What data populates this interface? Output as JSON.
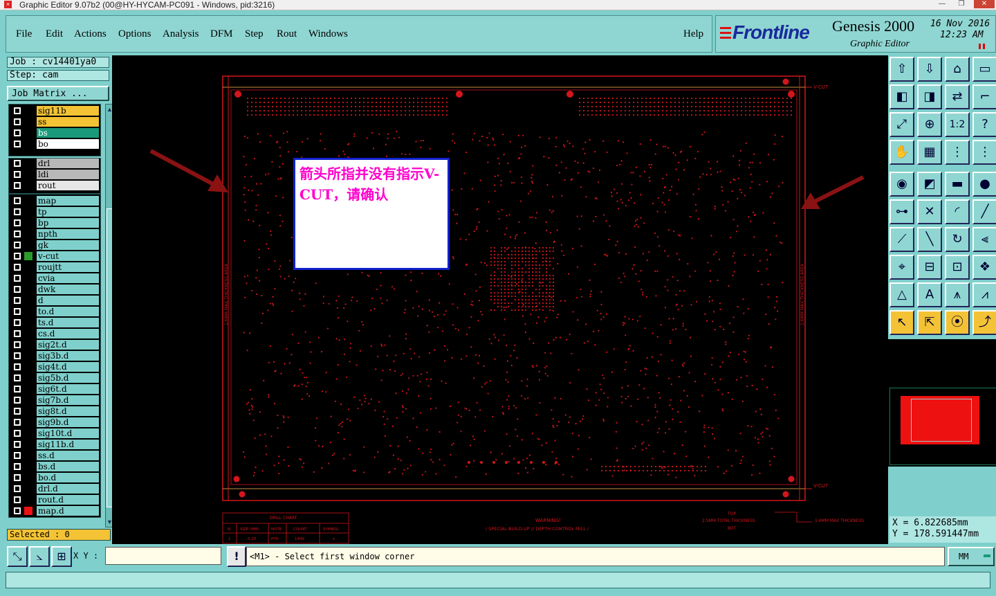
{
  "window": {
    "title": "Graphic Editor 9.07b2 (00@HY-HYCAM-PC091 - Windows, pid:3216)",
    "minimize": "—",
    "maximize": "❐",
    "close": "✕"
  },
  "menu": {
    "items": [
      "File",
      "Edit",
      "Actions",
      "Options",
      "Analysis",
      "DFM",
      "Step",
      "Rout",
      "Windows"
    ],
    "help": "Help"
  },
  "brand": {
    "logo": "Frontline",
    "product": "Genesis 2000",
    "subtitle": "Graphic Editor",
    "date": "16 Nov 2016",
    "time": "12:23 AM"
  },
  "left": {
    "job": "Job : cv14401ya0",
    "step": "Step: cam",
    "job_matrix": "Job Matrix ...",
    "group1": [
      {
        "name": "sig11b",
        "color": "#f3c335"
      },
      {
        "name": "ss",
        "color": "#f3c335"
      },
      {
        "name": "bs",
        "color": "#1a9a7a"
      },
      {
        "name": "bo",
        "color": "#ffffff"
      }
    ],
    "group2": [
      {
        "name": "drl",
        "color": "#b8b8b8"
      },
      {
        "name": "ldi",
        "color": "#b8b8b8"
      },
      {
        "name": "rout",
        "color": "#e6e6e6"
      }
    ],
    "group3": [
      "map",
      "tp",
      "bp",
      "npth",
      "gk",
      "v-cut",
      "roujtt",
      "cvia",
      "dwk",
      "d",
      "to.d",
      "ts.d",
      "cs.d",
      "sig2t.d",
      "sig3b.d",
      "sig4t.d",
      "sig5b.d",
      "sig6t.d",
      "sig7b.d",
      "sig8t.d",
      "sig9b.d",
      "sig10t.d",
      "sig11b.d",
      "ss.d",
      "bs.d",
      "bo.d",
      "drl.d",
      "rout.d",
      "map.d"
    ],
    "selected": "Selected : 0"
  },
  "canvas": {
    "annotation": "箭头所指并没有指示V-CUT，请确认",
    "vcut_label_top": "V-CUT",
    "vcut_label_bottom": "V-CUT",
    "side_text": "1.6MM MAX THICKNESS AREA",
    "drill_chart_title": "DRILL CHART",
    "drill_headers": [
      "N.",
      "SIZE (MM)",
      "NOTE",
      "COUNT",
      "SYMBOL"
    ],
    "drill_row": [
      "1",
      "0.20",
      "PTH",
      "1449",
      "+"
    ],
    "warning_title": "WARNING!",
    "warning_text": "/ SPECIAL BUILD-UP // DEPTH CONTROL MILL /",
    "thick_top": "TOP",
    "thick_total": "2.5MM TOTAL THICKNESS",
    "thick_bot": "BOT",
    "thick_max": "1.6MM MAX THICKNESS"
  },
  "right": {
    "coord_x": "X = 6.822685mm",
    "coord_y": "Y = 178.591447mm"
  },
  "bottom": {
    "xy_label": "X Y :",
    "xy_value": "",
    "message": "<M1> - Select first window corner",
    "units": "MM"
  },
  "colors": {
    "panel": "#7fd0cc",
    "canvas_bg": "#000000",
    "pcb_red": "#d4161c",
    "annotation_text": "#ff00cc"
  }
}
